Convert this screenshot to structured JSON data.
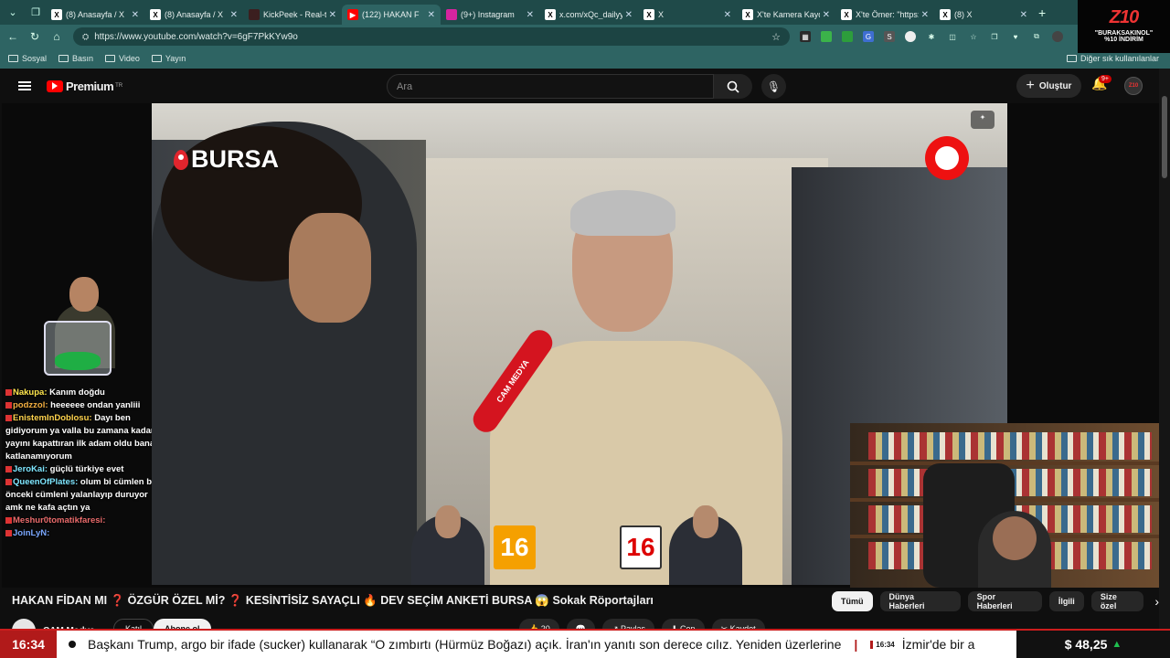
{
  "browser": {
    "tabs": [
      {
        "title": "(8) Anasayfa / X",
        "icon": "x-logo-icon",
        "color": "#ffffff"
      },
      {
        "title": "(8) Anasayfa / X",
        "icon": "x-logo-icon",
        "color": "#ffffff"
      },
      {
        "title": "KickPeek - Real-tim",
        "icon": "kickpeek-icon",
        "color": "#3b1f1f"
      },
      {
        "title": "(122) HAKAN F",
        "icon": "youtube-icon",
        "color": "#ff0000",
        "active": true
      },
      {
        "title": "(9+) Instagram",
        "icon": "instagram-icon",
        "color": "#d6249f"
      },
      {
        "title": "x.com/xQc_dailyy/st",
        "icon": "x-logo-icon",
        "color": "#ffffff"
      },
      {
        "title": "X",
        "icon": "x-logo-icon",
        "color": "#ffffff"
      },
      {
        "title": "X'te Kamera Kaydı Ur",
        "icon": "x-logo-icon",
        "color": "#ffffff"
      },
      {
        "title": "X'te Ömer: \"https://",
        "icon": "x-logo-icon",
        "color": "#ffffff"
      },
      {
        "title": "(8) X",
        "icon": "x-logo-icon",
        "color": "#ffffff"
      }
    ],
    "url": "https://www.youtube.com/watch?v=6gF7PkKYw9o",
    "bookmarks": [
      "Sosyal",
      "Basın",
      "Video",
      "Yayın"
    ],
    "bookmarks_other": "Diğer sık kullanılanlar"
  },
  "promo": {
    "logo": "Z10",
    "line1": "\"BURAKSAKINOL\"",
    "line2": "%10 İNDİRİM"
  },
  "youtube": {
    "logo_text": "Premium",
    "region": "TR",
    "search_placeholder": "Ara",
    "create_label": "Oluştur",
    "notif_count": "9+"
  },
  "video": {
    "location": "BURSA",
    "mic_text": "CAM MEDYA",
    "num_left": "16",
    "num_right": "16"
  },
  "chat": [
    {
      "user": "Nakupa:",
      "msg": "Kanım doğdu",
      "cls": "u1"
    },
    {
      "user": "podzzol:",
      "msg": "heeeeee ondan yanliii",
      "cls": "u2"
    },
    {
      "user": "EnistemInDoblosu:",
      "msg": "Dayı ben gidiyorum ya valla bu zamana kadar yayını kapattıran ilk adam oldu bana katlanamıyorum",
      "cls": "u3"
    },
    {
      "user": "JeroKai:",
      "msg": "güçlü türkiye evet",
      "cls": "u4"
    },
    {
      "user": "QueenOfPlates:",
      "msg": "olum bi cümlen bi önceki cümleni yalanlayıp duruyor amk ne kafa açtın ya",
      "cls": "u5"
    },
    {
      "user": "Meshur0tomatikfaresi:",
      "msg": "",
      "cls": "u6"
    },
    {
      "user": "JoinLyN:",
      "msg": "",
      "cls": "u7"
    }
  ],
  "below": {
    "title": "HAKAN FİDAN MI ❓ ÖZGÜR ÖZEL Mİ? ❓ KESİNTİSİZ SAYAÇLI 🔥 DEV SEÇİM ANKETİ BURSA 😱 Sokak Röportajları",
    "channel": "CAM Medya",
    "join": "Katıl",
    "subscribe": "Abone ol",
    "chips": [
      "Tümü",
      "Dünya Haberleri",
      "Spor Haberleri",
      "İlgili",
      "Size özel"
    ],
    "actions": [
      "👍 20",
      "💬",
      "↗ Paylaş",
      "⬇ Cep",
      "✂ Kaydet"
    ]
  },
  "ticker": {
    "time": "16:34",
    "text": "Başkanı Trump, argo bir ifade (sucker) kullanarak “O zımbırtı (Hürmüz Boğazı) açık. İran'ın yanıtı son derece cılız. Yeniden üzerlerine",
    "stamp": "16:34",
    "text2": "İzmir'de bir a",
    "price": "$ 48,25"
  }
}
